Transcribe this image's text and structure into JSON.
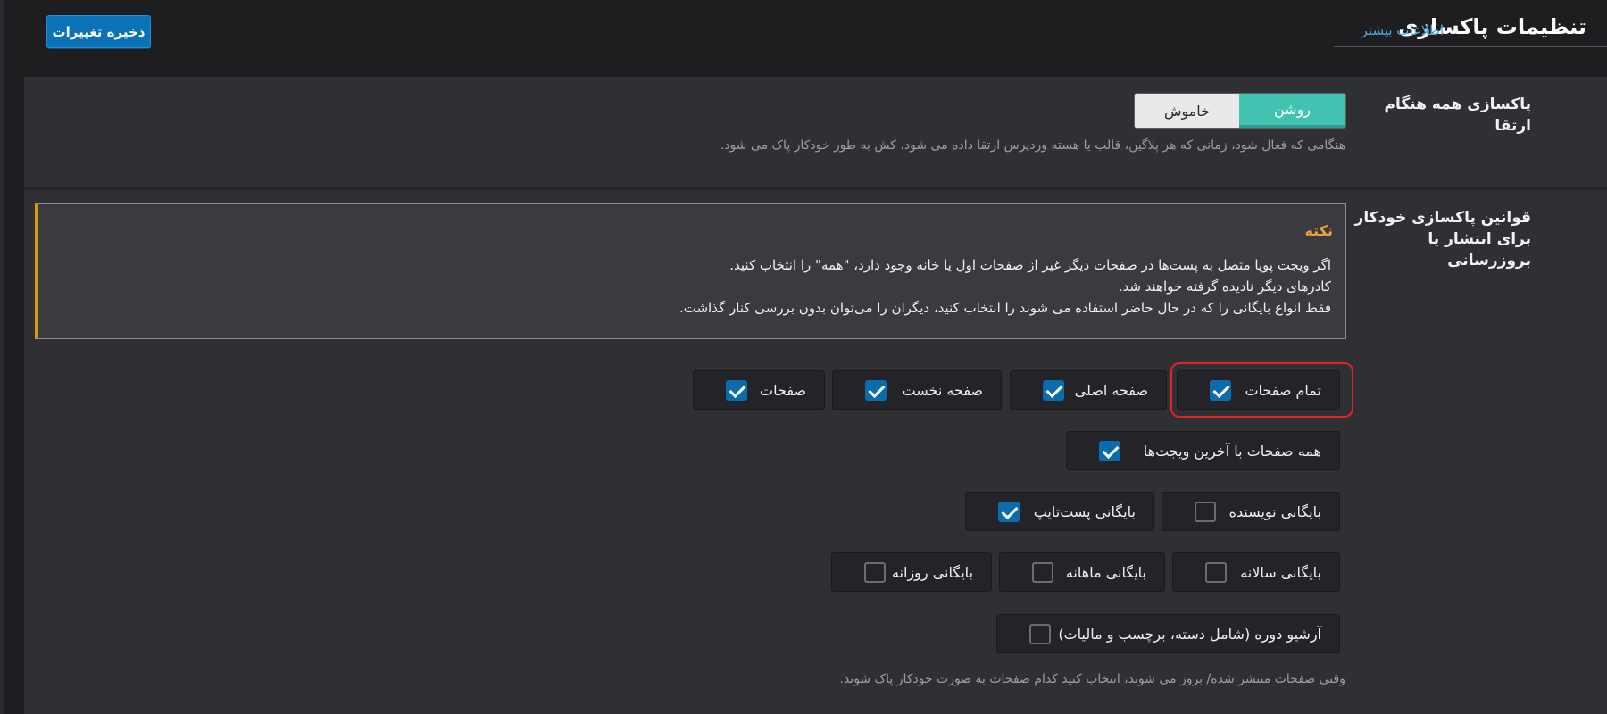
{
  "header": {
    "title": "تنظیمات پاکسازی",
    "more_link": "اطلاعات بیشتر",
    "save_label": "ذخیره تغییرات"
  },
  "purge_on_upgrade": {
    "label": "پاکسازی همه هنگام ارتقا",
    "toggle_on": "روشن",
    "toggle_off": "خاموش",
    "selected": "روشن",
    "description": "هنگامی که فعال شود، زمانی که هر پلاگین، قالب یا هسته وردپرس ارتقا داده می شود، کش به طور خودکار پاک می شود."
  },
  "auto_purge_rules": {
    "label": "قوانین پاکسازی خودکار برای انتشار یا بروزرسانی",
    "note": {
      "title": "نکته",
      "line1": "اگر ویجت پویا متصل به پست‌ها در صفحات دیگر غیر از صفحات اول یا خانه وجود دارد، \"همه\" را انتخاب کنید.",
      "line2": "کادرهای دیگر نادیده گرفته خواهند شد.",
      "line3": "فقط انواع بایگانی را که در حال حاضر استفاده می شوند را انتخاب کنید، دیگران را می‌توان بدون بررسی کنار گذاشت."
    },
    "options": {
      "all_pages": {
        "label": "تمام صفحات",
        "checked": true
      },
      "front_page": {
        "label": "صفحه اصلی",
        "checked": true
      },
      "home_page": {
        "label": "صفحه نخست",
        "checked": true
      },
      "pages": {
        "label": "صفحات",
        "checked": true
      },
      "all_recent_widgets": {
        "label": "همه صفحات با آخرین ویجت‌ها",
        "checked": true
      },
      "author_archive": {
        "label": "بایگانی نویسنده",
        "checked": false
      },
      "post_type_archive": {
        "label": "بایگانی پست‌تایپ",
        "checked": true
      },
      "yearly_archive": {
        "label": "بایگانی سالانه",
        "checked": false
      },
      "monthly_archive": {
        "label": "بایگانی ماهانه",
        "checked": false
      },
      "daily_archive": {
        "label": "بایگانی روزانه",
        "checked": false
      },
      "term_archive": {
        "label": "آرشیو دوره (شامل دسته، برچسب و مالیات)",
        "checked": false
      }
    },
    "description": "وقتی صفحات منتشر شده/ بروز می شوند، انتخاب کنید کدام صفحات به صورت خودکار پاک شوند."
  },
  "colors": {
    "accent": "#0b6cad",
    "toggle_on": "#42c3b2",
    "note_border": "#d79a13",
    "highlight": "#e0232a"
  }
}
